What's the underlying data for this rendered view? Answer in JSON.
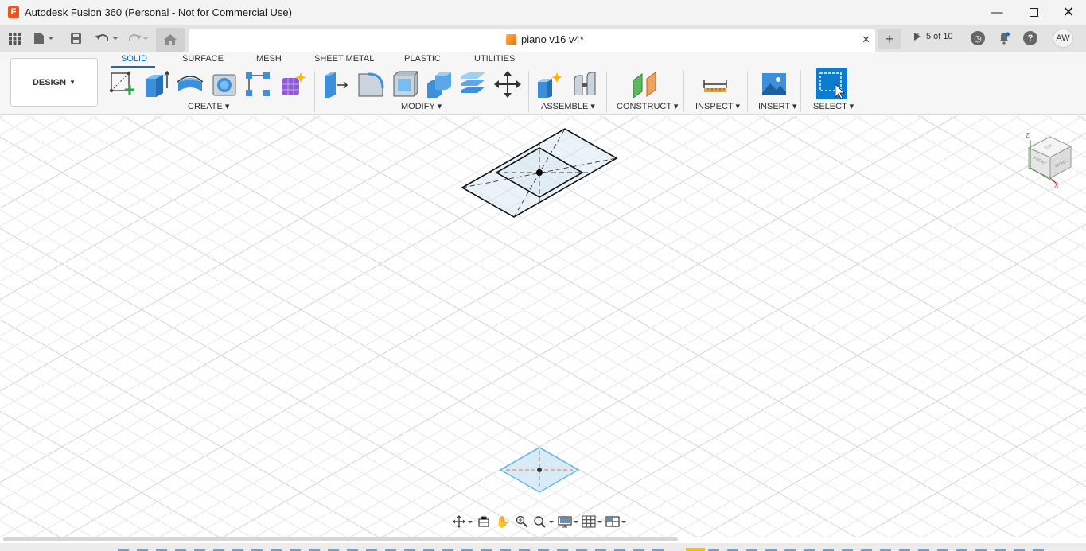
{
  "window": {
    "title": "Autodesk Fusion 360 (Personal - Not for Commercial Use)",
    "logo": "F",
    "controls": [
      "minimize-icon",
      "maximize-icon",
      "close-icon"
    ]
  },
  "tabbar": {
    "document_title": "piano v16 v4*",
    "jobs_label": "5 of 10",
    "avatar": "AW",
    "icons": [
      "grid-icon",
      "file-icon",
      "save-icon",
      "undo-icon",
      "redo-icon",
      "home-icon",
      "close-icon",
      "plus-icon",
      "clock-icon",
      "bell-icon",
      "help-icon"
    ]
  },
  "toolbar": {
    "workspace": "DESIGN",
    "tabs": [
      "SOLID",
      "SURFACE",
      "MESH",
      "SHEET METAL",
      "PLASTIC",
      "UTILITIES"
    ],
    "active_tab": "SOLID",
    "groups": {
      "create": "CREATE",
      "modify": "MODIFY",
      "assemble": "ASSEMBLE",
      "construct": "CONSTRUCT",
      "inspect": "INSPECT",
      "insert": "INSERT",
      "select": "SELECT"
    }
  },
  "viewcube": {
    "axes": [
      "Z",
      "X"
    ],
    "faces": [
      "TOP",
      "FRONT",
      "RIGHT"
    ]
  },
  "colors": {
    "accent": "#0a6fc4",
    "select_tile": "#0b7cd1",
    "logo": "#e8571f"
  }
}
